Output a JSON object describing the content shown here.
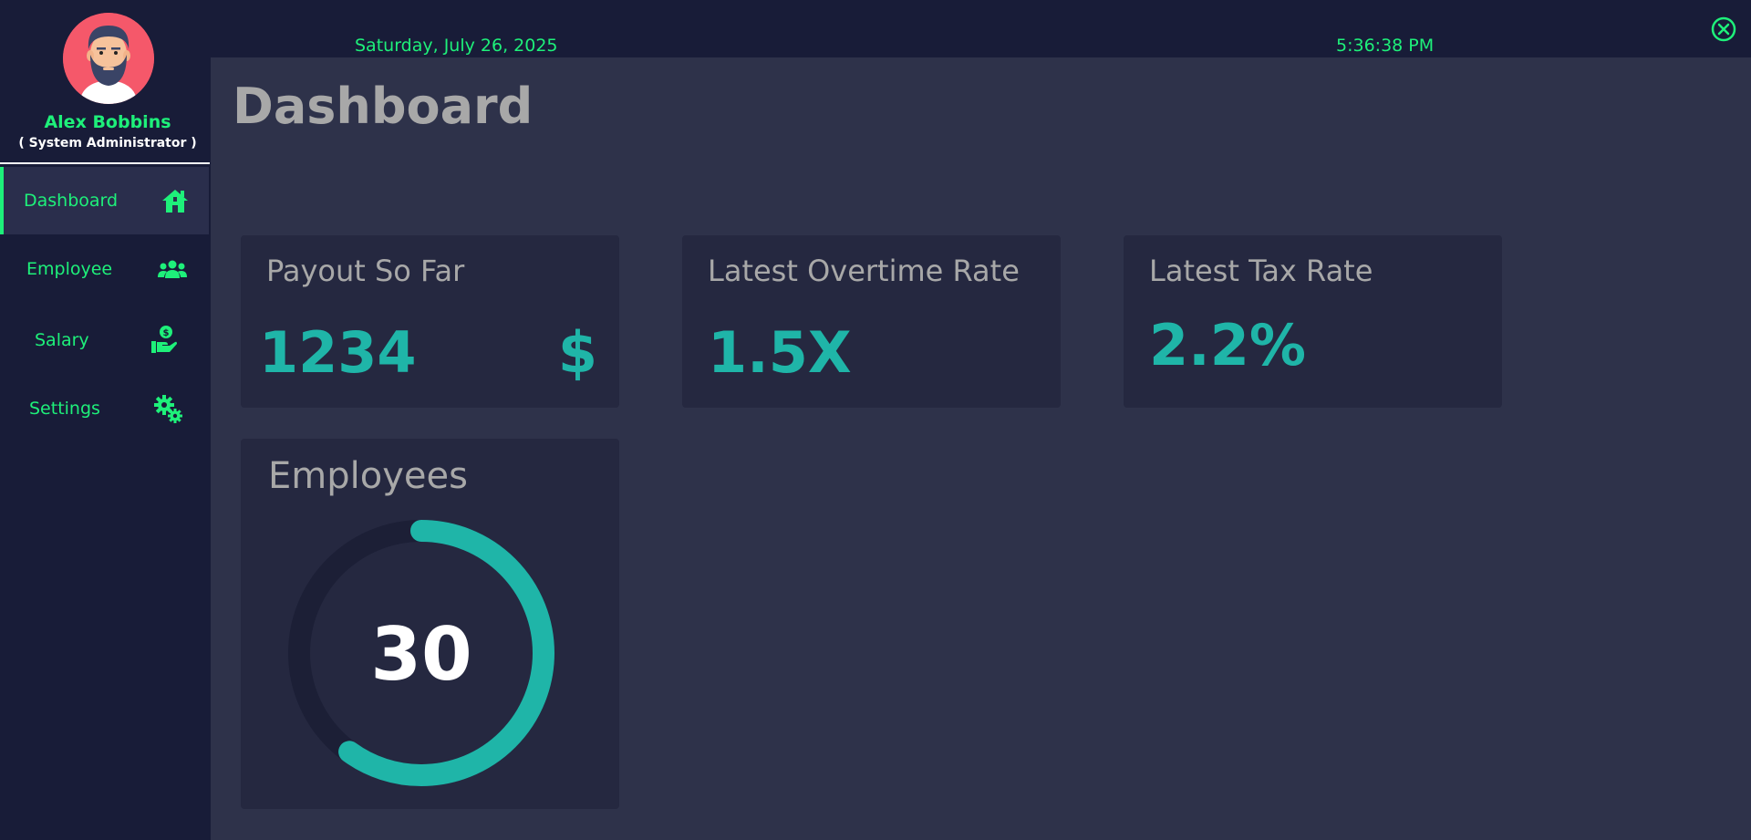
{
  "user": {
    "name": "Alex Bobbins",
    "role": "( System Administrator )"
  },
  "header": {
    "date": "Saturday, July 26, 2025",
    "time": "5:36:38 PM"
  },
  "sidebar": {
    "items": [
      {
        "label": "Dashboard",
        "icon": "home-icon",
        "active": true
      },
      {
        "label": "Employee",
        "icon": "users-icon",
        "active": false
      },
      {
        "label": "Salary",
        "icon": "salary-hand-icon",
        "active": false
      },
      {
        "label": "Settings",
        "icon": "gears-icon",
        "active": false
      }
    ]
  },
  "main": {
    "title": "Dashboard",
    "cards": {
      "payout": {
        "title": "Payout So Far",
        "value": "1234",
        "currency": "$"
      },
      "overtime": {
        "title": "Latest Overtime Rate",
        "value": "1.5X"
      },
      "tax": {
        "title": "Latest Tax Rate",
        "value": "2.2%"
      },
      "employees": {
        "title": "Employees",
        "value": "30",
        "progress_fraction": 0.6
      }
    }
  },
  "colors": {
    "accent_green": "#1ef07a",
    "teal": "#1fb5a8",
    "sidebar_bg": "#181c38",
    "main_bg": "#2e324a",
    "card_bg": "#252840"
  }
}
